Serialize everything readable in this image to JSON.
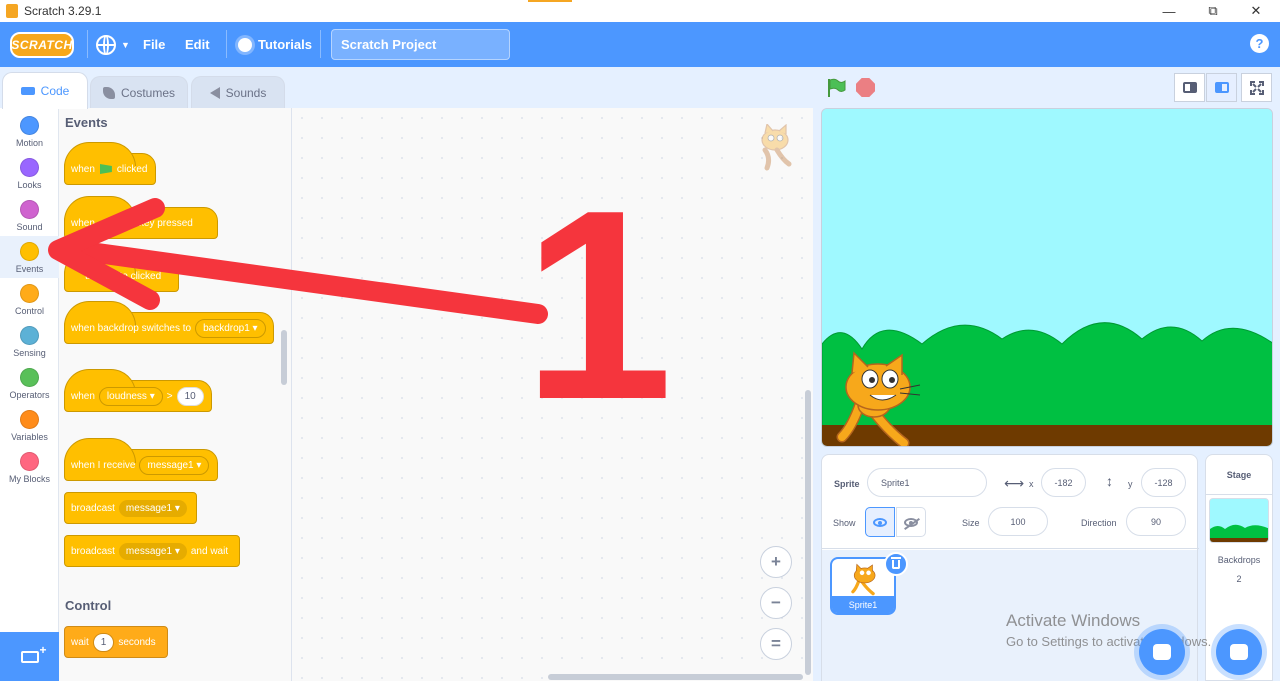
{
  "window": {
    "title": "Scratch 3.29.1",
    "minimize": "—",
    "restore": "⧉",
    "close": "✕"
  },
  "menubar": {
    "logo": "SCRATCH",
    "file": "File",
    "edit": "Edit",
    "tutorials": "Tutorials",
    "project_title": "Scratch Project",
    "help": "?"
  },
  "tabs": {
    "code": "Code",
    "costumes": "Costumes",
    "sounds": "Sounds"
  },
  "categories": [
    {
      "label": "Motion",
      "color": "#4c97ff"
    },
    {
      "label": "Looks",
      "color": "#9966ff"
    },
    {
      "label": "Sound",
      "color": "#cf63cf"
    },
    {
      "label": "Events",
      "color": "#ffbf00"
    },
    {
      "label": "Control",
      "color": "#ffab19"
    },
    {
      "label": "Sensing",
      "color": "#5cb1d6"
    },
    {
      "label": "Operators",
      "color": "#59c059"
    },
    {
      "label": "Variables",
      "color": "#ff8c1a"
    },
    {
      "label": "My Blocks",
      "color": "#ff6680"
    }
  ],
  "palette": {
    "events_heading": "Events",
    "control_heading": "Control",
    "b1_when": "when",
    "b1_clicked": "clicked",
    "b2_when": "when",
    "b2_rest": "key pressed",
    "b3_text": "this sprite clicked",
    "b4_text": "when backdrop switches to",
    "b4_dd": "backdrop1",
    "b5_when": "when",
    "b5_dd": "loudness",
    "b5_op": ">",
    "b5_num": "10",
    "b6_text": "when I receive",
    "b6_dd": "message1",
    "b7_text": "broadcast",
    "b7_dd": "message1",
    "b8_text": "broadcast",
    "b8_dd": "message1",
    "b8_tail": "and wait",
    "b9_wait": "wait",
    "b9_num": "1",
    "b9_seconds": "seconds"
  },
  "zoom": {
    "in": "+",
    "out": "−",
    "reset": "="
  },
  "sprite_info": {
    "sprite_label": "Sprite",
    "sprite_name": "Sprite1",
    "x_label": "x",
    "x_value": "-182",
    "y_label": "y",
    "y_value": "-128",
    "show_label": "Show",
    "size_label": "Size",
    "size_value": "100",
    "direction_label": "Direction",
    "direction_value": "90"
  },
  "sprite_list": [
    {
      "name": "Sprite1"
    }
  ],
  "stage_pane": {
    "title": "Stage",
    "backdrops_label": "Backdrops",
    "backdrops_count": "2"
  },
  "watermark": {
    "line1": "Activate Windows",
    "line2": "Go to Settings to activate Windows."
  },
  "annotation": {
    "number": "1",
    "color": "#f5353d"
  },
  "colors": {
    "accent": "#4c97ff",
    "events": "#ffbf00",
    "control": "#ffab19"
  }
}
